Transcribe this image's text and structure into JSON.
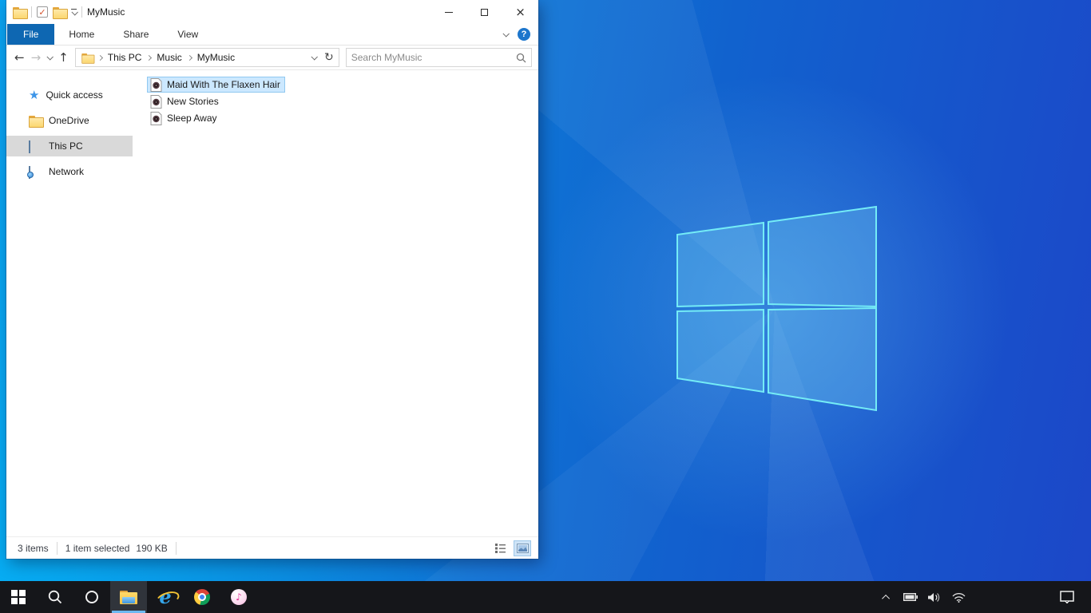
{
  "window": {
    "title": "MyMusic",
    "qat_icons": [
      "window-folder",
      "properties-check",
      "new-folder",
      "customize-quick-access"
    ]
  },
  "ribbon": {
    "tabs": [
      "File",
      "Home",
      "Share",
      "View"
    ],
    "active_tab": "File",
    "help_glyph": "?"
  },
  "navigation": {
    "back_glyph": "←",
    "forward_glyph": "→",
    "up_glyph": "↑",
    "refresh_glyph": "↻",
    "breadcrumb": [
      "This PC",
      "Music",
      "MyMusic"
    ],
    "search_placeholder": "Search MyMusic"
  },
  "sidebar": {
    "items": [
      {
        "label": "Quick access",
        "icon": "quick-access-star",
        "selected": false
      },
      {
        "label": "OneDrive",
        "icon": "folder",
        "selected": false
      },
      {
        "label": "This PC",
        "icon": "computer-monitor",
        "selected": true
      },
      {
        "label": "Network",
        "icon": "network-computer",
        "selected": false
      }
    ]
  },
  "files": {
    "items": [
      {
        "name": "Maid With The Flaxen Hair",
        "type": "audio",
        "selected": true
      },
      {
        "name": "New Stories",
        "type": "audio",
        "selected": false
      },
      {
        "name": "Sleep Away",
        "type": "audio",
        "selected": false
      }
    ]
  },
  "status": {
    "count": "3 items",
    "selection": "1 item selected",
    "size": "190 KB"
  },
  "taskbar": {
    "apps": [
      "start",
      "search",
      "cortana",
      "file-explorer",
      "internet-explorer",
      "chrome",
      "itunes"
    ],
    "active_app": "file-explorer",
    "tray": [
      "hidden-icons",
      "battery",
      "volume",
      "wifi",
      "action-center"
    ],
    "itunes_note_glyph": "♪",
    "star_glyph": "★",
    "check_glyph": "✓"
  },
  "colors": {
    "accent_tab_blue": "#0e67b2",
    "selection_bg": "#cce8ff",
    "selection_border": "#90c8f0",
    "sidebar_selected": "#d9d9d9",
    "taskbar_bg": "#15161a",
    "taskbar_active_underline": "#6cb8f0",
    "wallpaper_left": "#0aa3f0",
    "wallpaper_right": "#1c47c8",
    "logo_stroke": "#74ecf6"
  }
}
